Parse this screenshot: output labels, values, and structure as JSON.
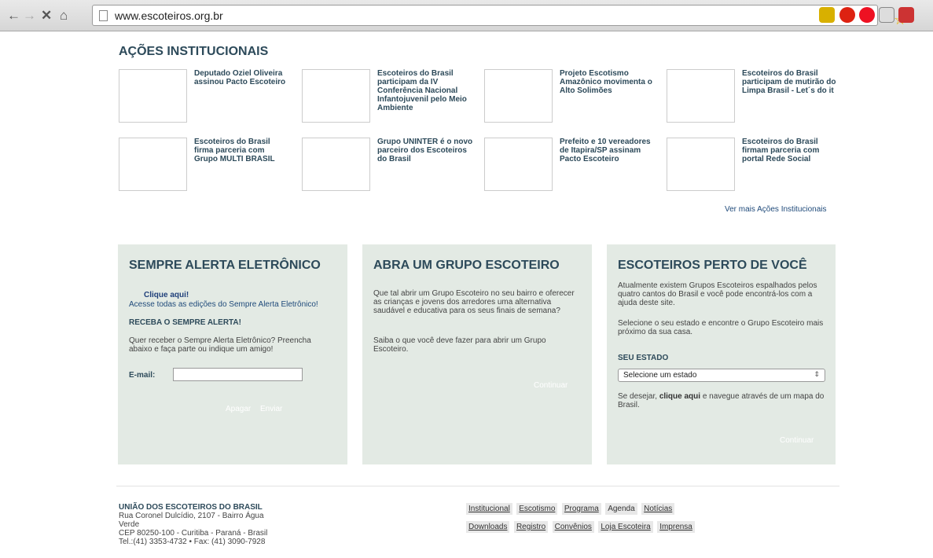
{
  "browser": {
    "url": "www.escoteiros.org.br"
  },
  "section": {
    "title": "AÇÕES INSTITUCIONAIS",
    "more_link": "Ver mais Ações Institucionais",
    "items": [
      {
        "title": "Deputado Oziel Oliveira assinou Pacto Escoteiro"
      },
      {
        "title": "Escoteiros do Brasil participam da IV Conferência Nacional Infantojuvenil pelo Meio Ambiente"
      },
      {
        "title": "Projeto Escotismo Amazônico movimenta o Alto Solimões"
      },
      {
        "title": "Escoteiros do Brasil participam de mutirão do Limpa Brasil - Let´s do it"
      },
      {
        "title": "Escoteiros do Brasil firma parceria com Grupo MULTI BRASIL"
      },
      {
        "title": "Grupo UNINTER é o novo parceiro dos Escoteiros do Brasil"
      },
      {
        "title": "Prefeito e 10 vereadores de Itapira/SP assinam Pacto Escoteiro"
      },
      {
        "title": "Escoteiros do Brasil firmam parceria com portal Rede Social"
      }
    ]
  },
  "panel_alert": {
    "title": "SEMPRE ALERTA ELETRÔNICO",
    "click_here": "Clique aqui!",
    "all_editions": "Acesse todas as edições do Sempre Alerta Eletrônico!",
    "subtitle": "RECEBA O SEMPRE ALERTA!",
    "description": "Quer receber o Sempre Alerta Eletrônico? Preencha abaixo e faça parte ou indique um amigo!",
    "email_label": "E-mail:",
    "email_value": "",
    "clear_button": "Apagar",
    "send_button": "Enviar"
  },
  "panel_group": {
    "title": "ABRA UM GRUPO ESCOTEIRO",
    "text1": "Que tal abrir um Grupo Escoteiro no seu bairro e oferecer as crianças e jovens dos arredores uma alternativa saudável e educativa para os seus finais de semana?",
    "text2": "Saiba o que você deve fazer para abrir um Grupo Escoteiro.",
    "continue_button": "Continuar"
  },
  "panel_near": {
    "title": "ESCOTEIROS PERTO DE VOCÊ",
    "text1": "Atualmente existem Grupos Escoteiros espalhados pelos quatro cantos do Brasil e você pode encontrá-los com a ajuda deste site.",
    "text2": "Selecione o seu estado e encontre o Grupo Escoteiro mais próximo da sua casa.",
    "state_label": "SEU ESTADO",
    "state_select": "Selecione um estado",
    "map_prefix": "Se desejar, ",
    "map_link": "clique aqui",
    "map_suffix": " e navegue através de um mapa do Brasil.",
    "continue_button": "Continuar"
  },
  "footer": {
    "org_name": "UNIÃO DOS ESCOTEIROS DO BRASIL",
    "address_line1": "Rua Coronel Dulcídio, 2107 - Bairro Água Verde",
    "address_line2": "CEP 80250-100 - Curitiba - Paraná - Brasil",
    "address_line3": "Tel.:(41) 3353-4732 • Fax: (41) 3090-7928",
    "links_row1": [
      "Institucional",
      "Escotismo",
      "Programa",
      "Agenda",
      "Notícias"
    ],
    "links_row2": [
      "Downloads",
      "Registro",
      "Convênios",
      "Loja Escoteira",
      "Imprensa"
    ]
  }
}
